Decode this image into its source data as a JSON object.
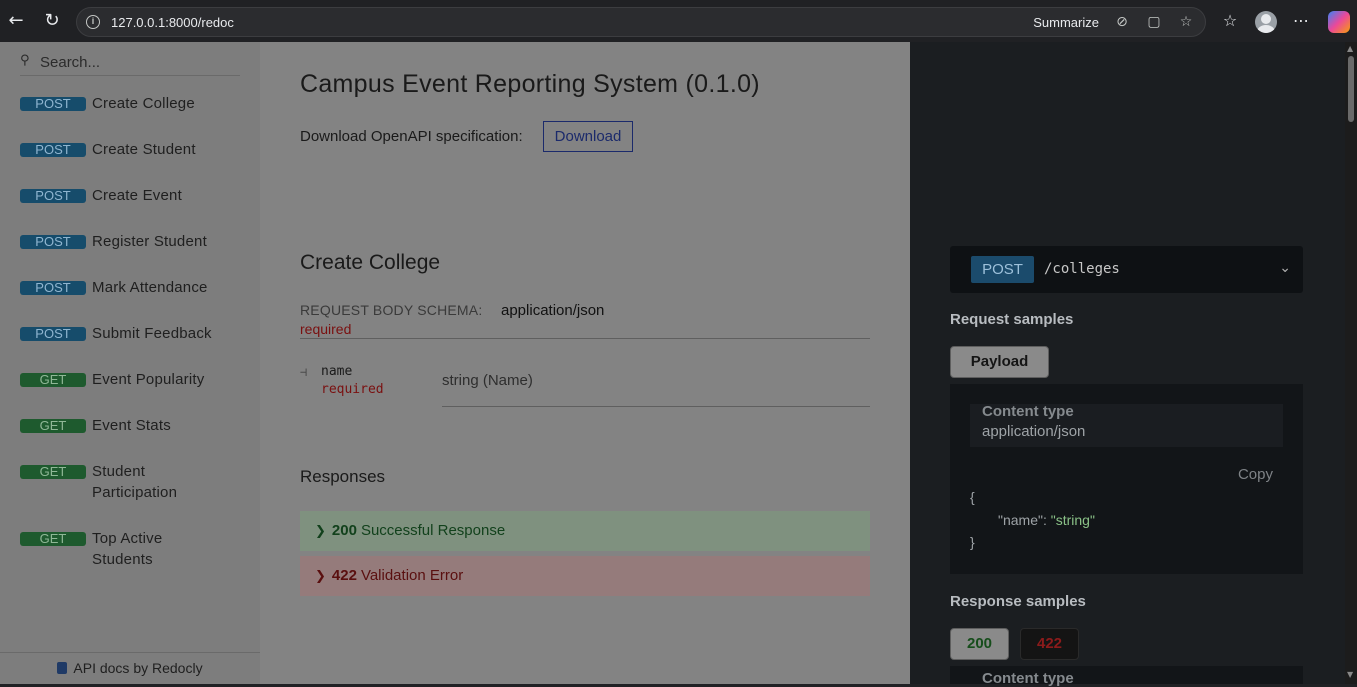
{
  "browser": {
    "url": "127.0.0.1:8000/redoc",
    "summarize_label": "Summarize"
  },
  "sidebar": {
    "search_placeholder": "Search...",
    "items": [
      {
        "method": "POST",
        "label": "Create College"
      },
      {
        "method": "POST",
        "label": "Create Student"
      },
      {
        "method": "POST",
        "label": "Create Event"
      },
      {
        "method": "POST",
        "label": "Register Student"
      },
      {
        "method": "POST",
        "label": "Mark Attendance"
      },
      {
        "method": "POST",
        "label": "Submit Feedback"
      },
      {
        "method": "GET",
        "label": "Event Popularity"
      },
      {
        "method": "GET",
        "label": "Event Stats"
      },
      {
        "method": "GET",
        "label": "Student Participation"
      },
      {
        "method": "GET",
        "label": "Top Active Students"
      }
    ],
    "footer": "API docs by Redocly"
  },
  "main": {
    "title": "Campus Event Reporting System (0.1.0)",
    "download_text": "Download OpenAPI specification:",
    "download_button": "Download",
    "section_title": "Create College",
    "schema_label": "REQUEST BODY SCHEMA:",
    "schema_type": "application/json",
    "required_label": "required",
    "field": {
      "name": "name",
      "required": "required",
      "type": "string (Name)"
    },
    "responses_title": "Responses",
    "responses": [
      {
        "code": "200",
        "text": "Successful Response"
      },
      {
        "code": "422",
        "text": "Validation Error"
      }
    ]
  },
  "right_panel": {
    "method": "POST",
    "path": "/colleges",
    "request_samples_title": "Request samples",
    "payload_tab": "Payload",
    "content_type_label": "Content type",
    "content_type_value": "application/json",
    "copy_label": "Copy",
    "json_open": "{",
    "json_key": "\"name\"",
    "json_colon": ": ",
    "json_value": "\"string\"",
    "json_close": "}",
    "response_samples_title": "Response samples",
    "response_tabs": [
      "200",
      "422"
    ],
    "content_type_label_2": "Content type"
  }
}
